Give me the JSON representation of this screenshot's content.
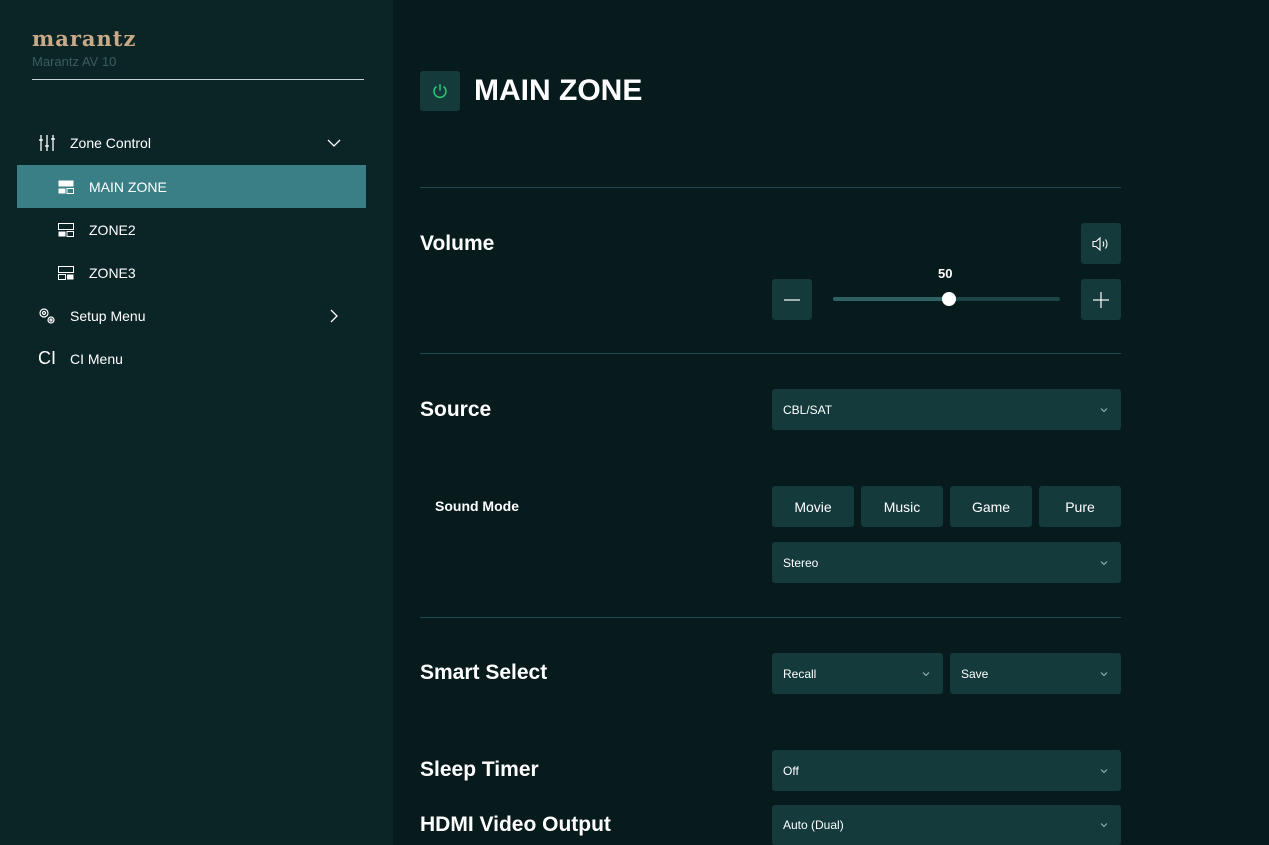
{
  "sidebar": {
    "brand": "marantz",
    "model": "Marantz AV 10",
    "zone_control": {
      "label": "Zone Control",
      "icon": "sliders-icon"
    },
    "zones": [
      {
        "label": "MAIN ZONE",
        "active": true
      },
      {
        "label": "ZONE2",
        "active": false
      },
      {
        "label": "ZONE3",
        "active": false
      }
    ],
    "setup_menu": {
      "label": "Setup Menu",
      "icon": "gears-icon"
    },
    "ci_menu": {
      "label": "CI Menu",
      "glyph": "CI"
    }
  },
  "main": {
    "title": "MAIN ZONE",
    "power_icon": "power-icon",
    "volume": {
      "label": "Volume",
      "value": "50",
      "level_fraction": 0.51,
      "speaker_icon": "speaker-icon"
    },
    "source": {
      "label": "Source",
      "selected": "CBL/SAT"
    },
    "sound_mode": {
      "label": "Sound Mode",
      "buttons": [
        "Movie",
        "Music",
        "Game",
        "Pure"
      ],
      "selected": "Stereo"
    },
    "smart_select": {
      "label": "Smart Select",
      "recall": "Recall",
      "save": "Save"
    },
    "sleep_timer": {
      "label": "Sleep Timer",
      "selected": "Off"
    },
    "hdmi_video_output": {
      "label": "HDMI Video Output",
      "selected": "Auto (Dual)"
    }
  },
  "colors": {
    "sidebar_bg": "#0b2527",
    "main_bg": "#071a1c",
    "control_bg": "#143a3c",
    "active_item": "#3a7f85",
    "brand": "#c8aa88",
    "power_green": "#2fd07a"
  }
}
